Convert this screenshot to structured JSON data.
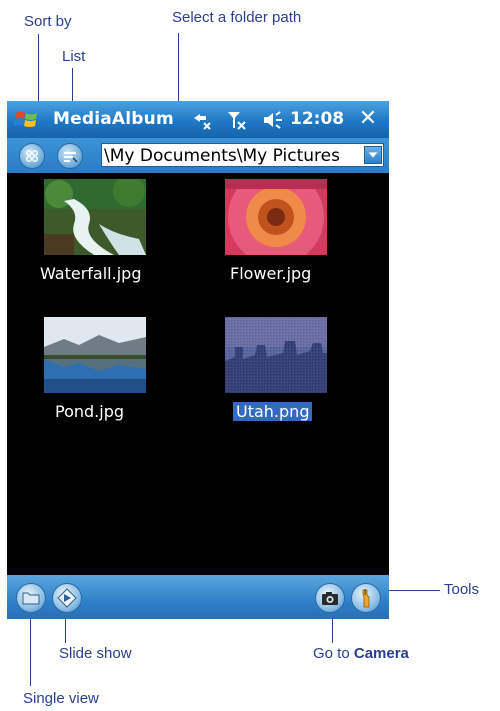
{
  "callouts": {
    "sort_by": "Sort by",
    "list": "List",
    "select_folder_path": "Select a folder path",
    "tools": "Tools",
    "slide_show": "Slide show",
    "go_to": "Go to ",
    "camera": "Camera",
    "single_view": "Single view"
  },
  "titlebar": {
    "app_title": "MediaAlbum",
    "time": "12:08",
    "close_glyph": "✕"
  },
  "toolbar": {
    "folder_path": "\\My Documents\\My Pictures"
  },
  "thumbnails": [
    {
      "label": "Waterfall.jpg",
      "icon": "waterfall-image"
    },
    {
      "label": "Flower.jpg",
      "icon": "flower-image"
    },
    {
      "label": "Pond.jpg",
      "icon": "pond-image"
    },
    {
      "label": "Utah.png",
      "icon": "utah-image",
      "selected": true
    }
  ],
  "colors": {
    "accent_blue": "#1f78c4",
    "callout_text": "#2a3f8f",
    "selection": "#316ac5"
  }
}
